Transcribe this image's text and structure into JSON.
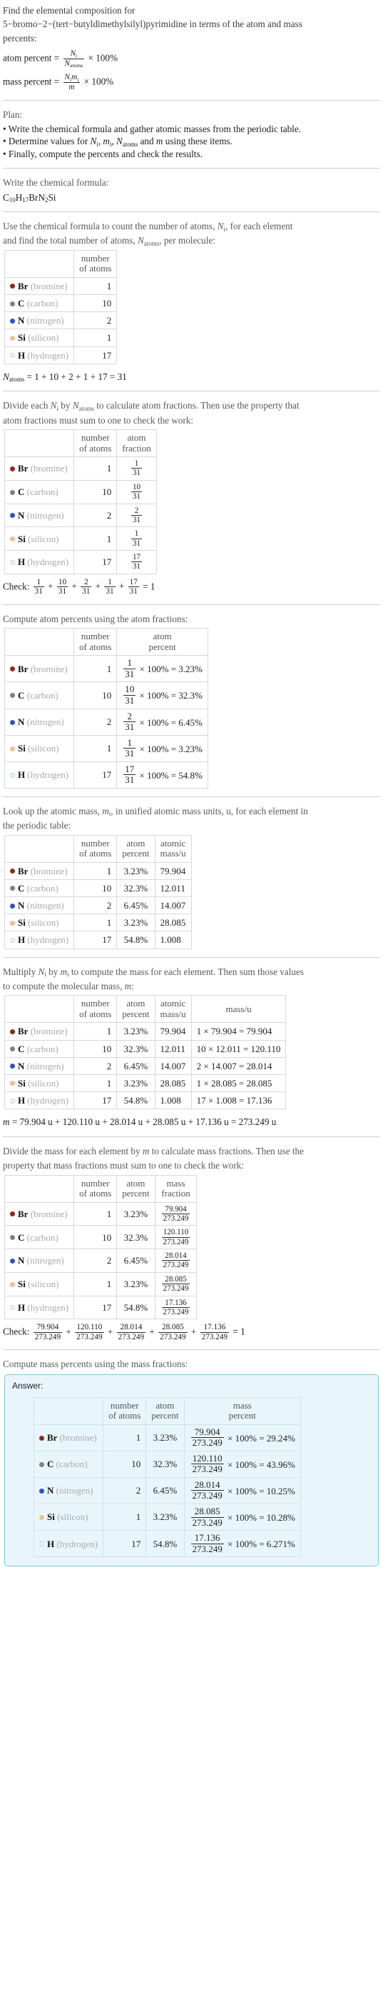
{
  "problem": {
    "line1": "Find the elemental composition for",
    "line2": "5−bromo−2−(tert−butyldimethylsilyl)pyrimidine in terms of the atom and mass",
    "line3": "percents:",
    "atom_percent_label": "atom percent =",
    "mass_percent_label": "mass percent =",
    "pct100": "× 100%"
  },
  "plan": {
    "heading": "Plan:",
    "items": [
      "• Write the chemical formula and gather atomic masses from the periodic table.",
      "• Determine values for N_i, m_i, N_atoms and m using these items.",
      "• Finally, compute the percents and check the results."
    ],
    "item2_a": "• Determine values for",
    "item2_b": "and",
    "item2_c": "using these items.",
    "item3": "• Finally, compute the percents and check the results."
  },
  "formula_section": {
    "heading": "Write the chemical formula:",
    "formula_parts": [
      {
        "sym": "C",
        "sub": "10"
      },
      {
        "sym": "H",
        "sub": "17"
      },
      {
        "sym": "Br",
        "sub": ""
      },
      {
        "sym": "N",
        "sub": "2"
      },
      {
        "sym": "Si",
        "sub": ""
      }
    ]
  },
  "count_section": {
    "heading_a": "Use the chemical formula to count the number of atoms,",
    "heading_b": ", for each element",
    "heading_c": "and find the total number of atoms,",
    "heading_d": ", per molecule:",
    "columns": [
      "",
      "number of atoms"
    ],
    "total_line": "= 1 + 10 + 2 + 1 + 17 = 31",
    "total_value": "31"
  },
  "fraction_section": {
    "heading_a": "Divide each",
    "heading_b": "by",
    "heading_c": "to calculate atom fractions. Then use the property that",
    "heading_d": "atom fractions must sum to one to check the work:",
    "columns": [
      "",
      "number of atoms",
      "atom fraction"
    ],
    "check_label": "Check:",
    "check_result": "= 1",
    "denominator": "31"
  },
  "atom_percent_section": {
    "heading": "Compute atom percents using the atom fractions:",
    "columns": [
      "",
      "number of atoms",
      "atom percent"
    ]
  },
  "atomic_mass_section": {
    "heading_a": "Look up the atomic mass,",
    "heading_b": ", in unified atomic mass units, u, for each element in",
    "heading_c": "the periodic table:",
    "columns": [
      "",
      "number of atoms",
      "atom percent",
      "atomic mass/u"
    ]
  },
  "mass_section": {
    "heading_a": "Multiply",
    "heading_b": "by",
    "heading_c": "to compute the mass for each element. Then sum those values",
    "heading_d": "to compute the molecular mass,",
    "heading_e": ":",
    "columns": [
      "",
      "number of atoms",
      "atom percent",
      "atomic mass/u",
      "mass/u"
    ],
    "molecular_mass_line": "= 79.904 u + 120.110 u + 28.014 u + 28.085 u + 17.136 u = 273.249 u",
    "molecular_mass": "273.249"
  },
  "mass_fraction_section": {
    "heading_a": "Divide the mass for each element by",
    "heading_b": "to calculate mass fractions. Then use the",
    "heading_c": "property that mass fractions must sum to one to check the work:",
    "columns": [
      "",
      "number of atoms",
      "atom percent",
      "mass fraction"
    ],
    "check_label": "Check:",
    "check_result": "= 1"
  },
  "mass_percent_section": {
    "heading": "Compute mass percents using the mass fractions:",
    "answer_label": "Answer:",
    "columns": [
      "",
      "number of atoms",
      "atom percent",
      "mass percent"
    ]
  },
  "elements": [
    {
      "symbol": "Br",
      "name": "(bromine)",
      "color": "#8a2b20",
      "filled": true,
      "count": "1",
      "atom_fraction_num": "1",
      "atom_fraction_den": "31",
      "atom_percent": "3.23%",
      "atomic_mass": "79.904",
      "mass_expr": "1 × 79.904 = 79.904",
      "mass": "79.904",
      "mass_fraction_num": "79.904",
      "mass_fraction_den": "273.249",
      "mass_percent": "29.24%"
    },
    {
      "symbol": "C",
      "name": "(carbon)",
      "color": "#808080",
      "filled": true,
      "count": "10",
      "atom_fraction_num": "10",
      "atom_fraction_den": "31",
      "atom_percent": "32.3%",
      "atomic_mass": "12.011",
      "mass_expr": "10 × 12.011 = 120.110",
      "mass": "120.110",
      "mass_fraction_num": "120.110",
      "mass_fraction_den": "273.249",
      "mass_percent": "43.96%"
    },
    {
      "symbol": "N",
      "name": "(nitrogen)",
      "color": "#3050c8",
      "filled": true,
      "count": "2",
      "atom_fraction_num": "2",
      "atom_fraction_den": "31",
      "atom_percent": "6.45%",
      "atomic_mass": "14.007",
      "mass_expr": "2 × 14.007 = 28.014",
      "mass": "28.014",
      "mass_fraction_num": "28.014",
      "mass_fraction_den": "273.249",
      "mass_percent": "10.25%"
    },
    {
      "symbol": "Si",
      "name": "(silicon)",
      "color": "#f0c090",
      "filled": true,
      "count": "1",
      "atom_fraction_num": "1",
      "atom_fraction_den": "31",
      "atom_percent": "3.23%",
      "atomic_mass": "28.085",
      "mass_expr": "1 × 28.085 = 28.085",
      "mass": "28.085",
      "mass_fraction_num": "28.085",
      "mass_fraction_den": "273.249",
      "mass_percent": "10.28%"
    },
    {
      "symbol": "H",
      "name": "(hydrogen)",
      "color": "#eaf6fb",
      "filled": false,
      "count": "17",
      "atom_fraction_num": "17",
      "atom_fraction_den": "31",
      "atom_percent": "54.8%",
      "atomic_mass": "1.008",
      "mass_expr": "17 × 1.008 = 17.136",
      "mass": "17.136",
      "mass_fraction_num": "17.136",
      "mass_fraction_den": "273.249",
      "mass_percent": "6.271%"
    }
  ],
  "symbols": {
    "Ni": "N",
    "Ni_sub": "i",
    "mi": "m",
    "mi_sub": "i",
    "Natoms": "N",
    "Natoms_sub": "atoms",
    "m": "m",
    "times100": "× 100%"
  }
}
